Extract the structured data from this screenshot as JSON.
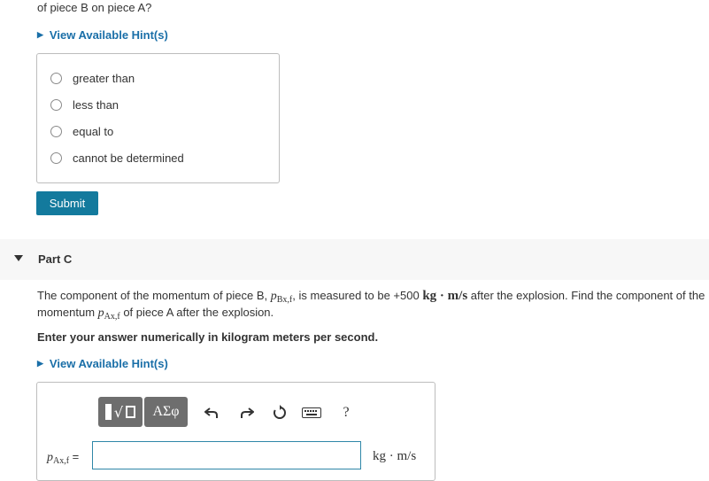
{
  "prev_question": {
    "tail_text": "of piece B on piece A?"
  },
  "partb": {
    "hint_label": "View Available Hint(s)",
    "choices": [
      "greater than",
      "less than",
      "equal to",
      "cannot be determined"
    ],
    "submit_label": "Submit"
  },
  "partc": {
    "title": "Part C",
    "q1_pre": "The component of the momentum of piece B, ",
    "q1_sym": "p",
    "q1_sub": "Bx,f",
    "q1_mid": ", is measured to be +500 ",
    "q1_unit": "kg · m/s",
    "q1_post": " after the explosion. Find the component of the",
    "q2_pre": "momentum ",
    "q2_sym": "p",
    "q2_sub": "Ax,f",
    "q2_post": " of piece A after the explosion.",
    "instruction": "Enter your answer numerically in kilogram meters per second.",
    "hint_label": "View Available Hint(s)",
    "toolbar": {
      "greek_label": "ΑΣφ",
      "help_label": "?"
    },
    "answer": {
      "label_sym": "p",
      "label_sub": "Ax,f",
      "label_eq": " =",
      "value": "",
      "units": "kg · m/s"
    }
  },
  "colors": {
    "link": "#1a6fa8",
    "submit_bg": "#137a9d",
    "toolbar_bg": "#6e6e6e",
    "input_border": "#2f87a8"
  }
}
